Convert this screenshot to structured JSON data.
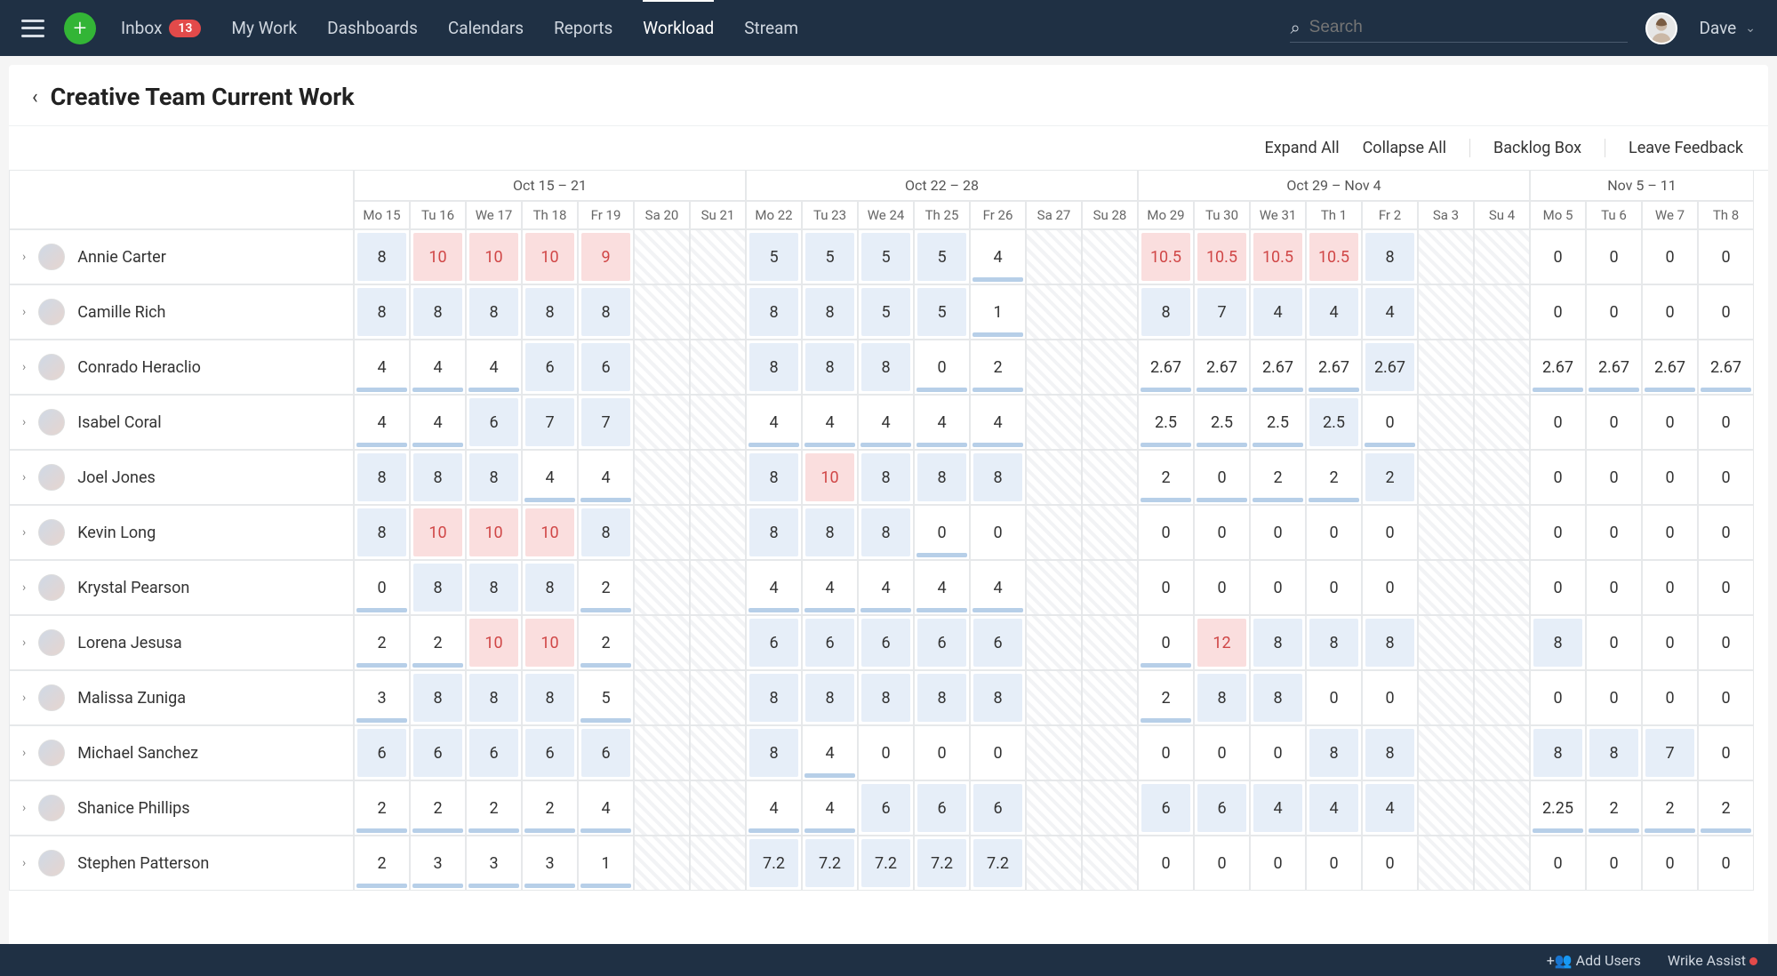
{
  "nav": {
    "inbox_label": "Inbox",
    "inbox_badge": "13",
    "items": [
      "My Work",
      "Dashboards",
      "Calendars",
      "Reports",
      "Workload",
      "Stream"
    ],
    "active_index": 4
  },
  "search": {
    "placeholder": "Search"
  },
  "user": {
    "name": "Dave"
  },
  "page": {
    "title": "Creative Team Current Work"
  },
  "toolbar": {
    "expand": "Expand All",
    "collapse": "Collapse All",
    "backlog": "Backlog Box",
    "feedback": "Leave Feedback"
  },
  "weeks": [
    {
      "label": "Oct 15 – 21",
      "days": [
        "Mo 15",
        "Tu 16",
        "We 17",
        "Th 18",
        "Fr 19",
        "Sa 20",
        "Su 21"
      ]
    },
    {
      "label": "Oct 22 – 28",
      "days": [
        "Mo 22",
        "Tu 23",
        "We 24",
        "Th 25",
        "Fr 26",
        "Sa 27",
        "Su 28"
      ]
    },
    {
      "label": "Oct 29 – Nov 4",
      "days": [
        "Mo 29",
        "Tu 30",
        "We 31",
        "Th 1",
        "Fr 2",
        "Sa 3",
        "Su 4"
      ]
    },
    {
      "label": "Nov 5 – 11",
      "days": [
        "Mo 5",
        "Tu 6",
        "We 7",
        "Th 8"
      ]
    }
  ],
  "people": [
    {
      "name": "Annie Carter",
      "vals": [
        "8",
        "10",
        "10",
        "10",
        "9",
        "",
        "",
        "5",
        "5",
        "5",
        "5",
        "4",
        "",
        "",
        "10.5",
        "10.5",
        "10.5",
        "10.5",
        "8",
        "",
        "",
        "0",
        "0",
        "0",
        "0"
      ]
    },
    {
      "name": "Camille Rich",
      "vals": [
        "8",
        "8",
        "8",
        "8",
        "8",
        "",
        "",
        "8",
        "8",
        "5",
        "5",
        "1",
        "",
        "",
        "8",
        "7",
        "4",
        "4",
        "4",
        "",
        "",
        "0",
        "0",
        "0",
        "0"
      ]
    },
    {
      "name": "Conrado Heraclio",
      "vals": [
        "4",
        "4",
        "4",
        "6",
        "6",
        "",
        "",
        "8",
        "8",
        "8",
        "0",
        "2",
        "",
        "",
        "2.67",
        "2.67",
        "2.67",
        "2.67",
        "2.67",
        "",
        "",
        "2.67",
        "2.67",
        "2.67",
        "2.67"
      ]
    },
    {
      "name": "Isabel Coral",
      "vals": [
        "4",
        "4",
        "6",
        "7",
        "7",
        "",
        "",
        "4",
        "4",
        "4",
        "4",
        "4",
        "",
        "",
        "2.5",
        "2.5",
        "2.5",
        "2.5",
        "0",
        "",
        "",
        "0",
        "0",
        "0",
        "0"
      ]
    },
    {
      "name": "Joel Jones",
      "vals": [
        "8",
        "8",
        "8",
        "4",
        "4",
        "",
        "",
        "8",
        "10",
        "8",
        "8",
        "8",
        "",
        "",
        "2",
        "0",
        "2",
        "2",
        "2",
        "",
        "",
        "0",
        "0",
        "0",
        "0"
      ]
    },
    {
      "name": "Kevin Long",
      "vals": [
        "8",
        "10",
        "10",
        "10",
        "8",
        "",
        "",
        "8",
        "8",
        "8",
        "0",
        "0",
        "",
        "",
        "0",
        "0",
        "0",
        "0",
        "0",
        "",
        "",
        "0",
        "0",
        "0",
        "0"
      ]
    },
    {
      "name": "Krystal Pearson",
      "vals": [
        "0",
        "8",
        "8",
        "8",
        "2",
        "",
        "",
        "4",
        "4",
        "4",
        "4",
        "4",
        "",
        "",
        "0",
        "0",
        "0",
        "0",
        "0",
        "",
        "",
        "0",
        "0",
        "0",
        "0"
      ]
    },
    {
      "name": "Lorena Jesusa",
      "vals": [
        "2",
        "2",
        "10",
        "10",
        "2",
        "",
        "",
        "6",
        "6",
        "6",
        "6",
        "6",
        "",
        "",
        "0",
        "12",
        "8",
        "8",
        "8",
        "",
        "",
        "8",
        "0",
        "0",
        "0"
      ]
    },
    {
      "name": "Malissa Zuniga",
      "vals": [
        "3",
        "8",
        "8",
        "8",
        "5",
        "",
        "",
        "8",
        "8",
        "8",
        "8",
        "8",
        "",
        "",
        "2",
        "8",
        "8",
        "0",
        "0",
        "",
        "",
        "0",
        "0",
        "0",
        "0"
      ]
    },
    {
      "name": "Michael Sanchez",
      "vals": [
        "6",
        "6",
        "6",
        "6",
        "6",
        "",
        "",
        "8",
        "4",
        "0",
        "0",
        "0",
        "",
        "",
        "0",
        "0",
        "0",
        "8",
        "8",
        "",
        "",
        "8",
        "8",
        "7",
        "0"
      ]
    },
    {
      "name": "Shanice Phillips",
      "vals": [
        "2",
        "2",
        "2",
        "2",
        "4",
        "",
        "",
        "4",
        "4",
        "6",
        "6",
        "6",
        "",
        "",
        "6",
        "6",
        "4",
        "4",
        "4",
        "",
        "",
        "2.25",
        "2",
        "2",
        "2"
      ]
    },
    {
      "name": "Stephen Patterson",
      "vals": [
        "2",
        "3",
        "3",
        "3",
        "1",
        "",
        "",
        "7.2",
        "7.2",
        "7.2",
        "7.2",
        "7.2",
        "",
        "",
        "0",
        "0",
        "0",
        "0",
        "0",
        "",
        "",
        "0",
        "0",
        "0",
        "0"
      ]
    }
  ],
  "cell_styles": {
    "blue_set": {
      "Annie Carter": [
        0,
        7,
        8,
        9,
        10,
        18
      ],
      "Camille Rich": [
        0,
        1,
        2,
        3,
        4,
        7,
        8,
        9,
        10,
        14,
        15,
        16,
        17,
        18
      ],
      "Conrado Heraclio": [
        3,
        4,
        7,
        8,
        9,
        18
      ],
      "Isabel Coral": [
        2,
        3,
        4,
        17
      ],
      "Joel Jones": [
        0,
        1,
        2,
        7,
        9,
        10,
        11,
        18
      ],
      "Kevin Long": [
        0,
        4,
        7,
        8,
        9
      ],
      "Krystal Pearson": [
        1,
        2,
        3
      ],
      "Lorena Jesusa": [
        7,
        8,
        9,
        10,
        11,
        16,
        17,
        18,
        21
      ],
      "Malissa Zuniga": [
        1,
        2,
        3,
        7,
        8,
        9,
        10,
        11,
        15,
        16
      ],
      "Michael Sanchez": [
        0,
        1,
        2,
        3,
        4,
        7,
        17,
        18,
        21,
        22,
        23
      ],
      "Shanice Phillips": [
        9,
        10,
        11,
        14,
        15,
        16,
        17,
        18
      ],
      "Stephen Patterson": [
        7,
        8,
        9,
        10,
        11
      ]
    },
    "red_set": {
      "Annie Carter": [
        1,
        2,
        3,
        4,
        14,
        15,
        16,
        17
      ],
      "Joel Jones": [
        8
      ],
      "Kevin Long": [
        1,
        2,
        3
      ],
      "Lorena Jesusa": [
        2,
        3,
        15
      ]
    },
    "bar_set": {
      "Annie Carter": [
        11
      ],
      "Camille Rich": [
        11
      ],
      "Conrado Heraclio": [
        0,
        1,
        2,
        10,
        11,
        14,
        15,
        16,
        17,
        21,
        22,
        23,
        24
      ],
      "Isabel Coral": [
        0,
        1,
        7,
        8,
        9,
        10,
        11,
        14,
        15,
        16,
        18
      ],
      "Joel Jones": [
        3,
        4,
        14,
        15,
        16,
        17
      ],
      "Kevin Long": [
        10
      ],
      "Krystal Pearson": [
        0,
        4,
        7,
        8,
        9,
        10,
        11
      ],
      "Lorena Jesusa": [
        0,
        1,
        4,
        14
      ],
      "Malissa Zuniga": [
        0,
        4,
        14
      ],
      "Michael Sanchez": [
        8
      ],
      "Shanice Phillips": [
        0,
        1,
        2,
        3,
        4,
        7,
        8,
        21,
        22,
        23,
        24
      ],
      "Stephen Patterson": [
        0,
        1,
        2,
        3,
        4
      ]
    }
  },
  "footer": {
    "add_users": "Add Users",
    "assist": "Wrike Assist"
  }
}
